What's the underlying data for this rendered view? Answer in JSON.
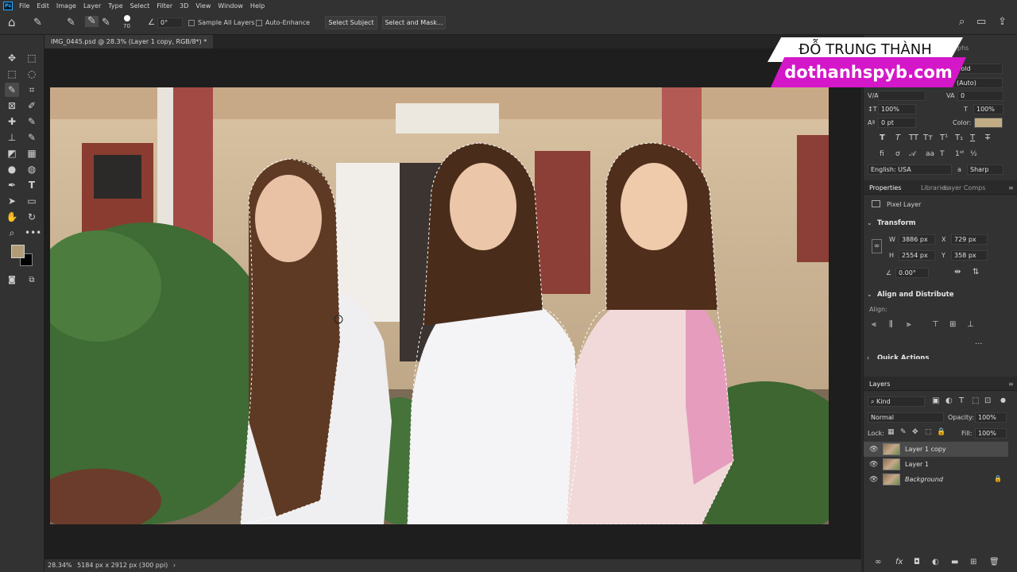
{
  "app": {
    "logo_text": "Ps"
  },
  "menubar": {
    "items": [
      "File",
      "Edit",
      "Image",
      "Layer",
      "Type",
      "Select",
      "Filter",
      "3D",
      "View",
      "Window",
      "Help"
    ]
  },
  "options": {
    "brush_size": "70",
    "angle": "0°",
    "sample_all_layers": "Sample All Layers",
    "auto_enhance": "Auto-Enhance",
    "select_subject": "Select Subject",
    "select_and_mask": "Select and Mask..."
  },
  "document": {
    "tab_title": "IMG_0445.psd @ 28.3% (Layer 1 copy, RGB/8*) *"
  },
  "status": {
    "zoom": "28.34%",
    "info": "5184 px x 2912 px (300 ppi)"
  },
  "watermark": {
    "top": "ĐỖ TRUNG THÀNH",
    "bottom": "dothanhspyb.com"
  },
  "character": {
    "tab_partial": "phs",
    "font_style": "Bold",
    "leading": "(Auto)",
    "kerning_label": "V/A",
    "tracking": "0",
    "vscale": "100%",
    "hscale": "100%",
    "baseline": "0 pt",
    "color_label": "Color:",
    "color_swatch": "#c2ac85",
    "language": "English: USA",
    "aa_label": "a",
    "antialias": "Sharp"
  },
  "properties": {
    "tabs": [
      "Properties",
      "Libraries",
      "Layer Comps"
    ],
    "kind": "Pixel Layer",
    "transform_title": "Transform",
    "w_label": "W",
    "w": "3886 px",
    "x_label": "X",
    "x": "729 px",
    "h_label": "H",
    "h": "2554 px",
    "y_label": "Y",
    "y": "358 px",
    "angle": "0.00°",
    "align_title": "Align and Distribute",
    "align_label": "Align:",
    "more": "...",
    "quick_actions": "Quick Actions"
  },
  "layers": {
    "tab": "Layers",
    "filter": "Kind",
    "blend": "Normal",
    "opacity_label": "Opacity:",
    "opacity": "100%",
    "lock_label": "Lock:",
    "fill_label": "Fill:",
    "fill": "100%",
    "items": [
      {
        "name": "Layer 1 copy",
        "selected": true
      },
      {
        "name": "Layer 1",
        "selected": false
      },
      {
        "name": "Background",
        "selected": false,
        "locked": true
      }
    ]
  },
  "colors": {
    "foreground": "#b29c77",
    "background": "#000000",
    "accent": "#d417c8"
  }
}
